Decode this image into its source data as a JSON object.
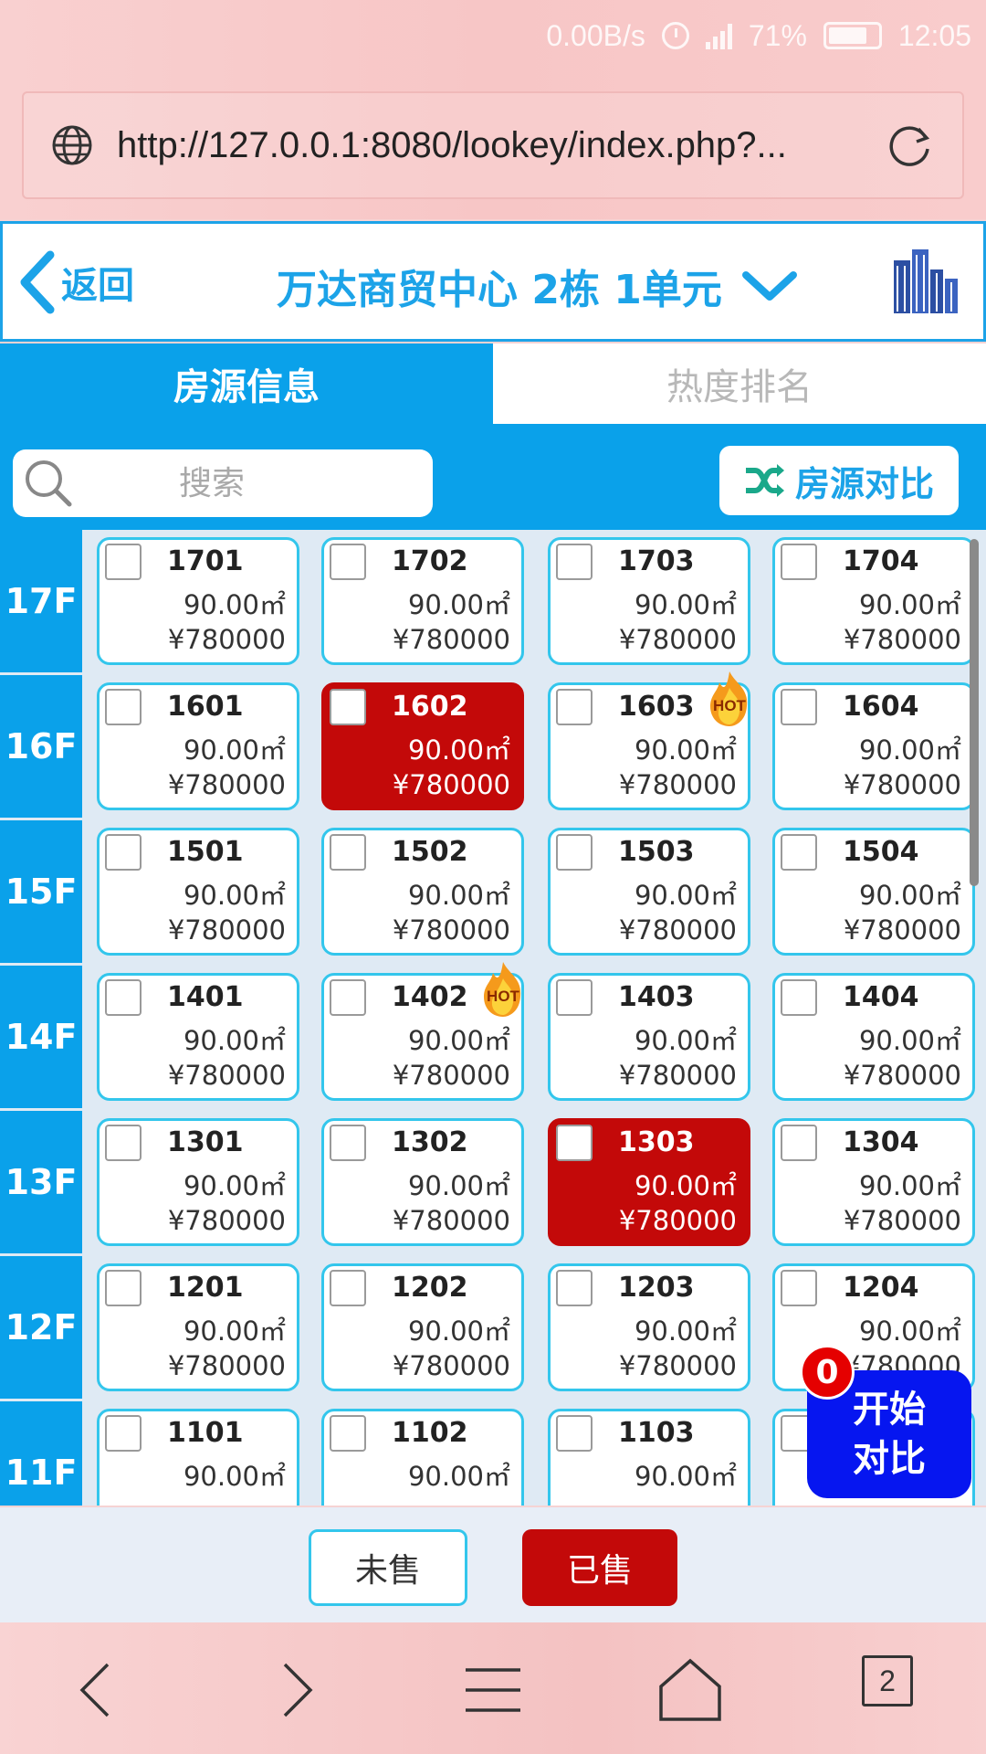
{
  "status_bar": {
    "speed": "0.00B/s",
    "network": "4G",
    "battery": "71%",
    "time": "12:05"
  },
  "browser": {
    "url": "http://127.0.0.1:8080/lookey/index.php?...",
    "tab_count": "2"
  },
  "header": {
    "back_label": "返回",
    "title": "万达商贸中心 2栋 1单元"
  },
  "tabs": [
    {
      "label": "房源信息",
      "active": true
    },
    {
      "label": "热度排名",
      "active": false
    }
  ],
  "search": {
    "placeholder": "搜索"
  },
  "compare_button": {
    "label": "房源对比"
  },
  "floors": [
    {
      "label": "17F",
      "units": [
        {
          "number": "1701",
          "area": "90.00㎡",
          "price": "¥780000",
          "sold": false,
          "hot": false
        },
        {
          "number": "1702",
          "area": "90.00㎡",
          "price": "¥780000",
          "sold": false,
          "hot": false
        },
        {
          "number": "1703",
          "area": "90.00㎡",
          "price": "¥780000",
          "sold": false,
          "hot": false
        },
        {
          "number": "1704",
          "area": "90.00㎡",
          "price": "¥780000",
          "sold": false,
          "hot": false
        }
      ]
    },
    {
      "label": "16F",
      "units": [
        {
          "number": "1601",
          "area": "90.00㎡",
          "price": "¥780000",
          "sold": false,
          "hot": false
        },
        {
          "number": "1602",
          "area": "90.00㎡",
          "price": "¥780000",
          "sold": true,
          "hot": false
        },
        {
          "number": "1603",
          "area": "90.00㎡",
          "price": "¥780000",
          "sold": false,
          "hot": true
        },
        {
          "number": "1604",
          "area": "90.00㎡",
          "price": "¥780000",
          "sold": false,
          "hot": false
        }
      ]
    },
    {
      "label": "15F",
      "units": [
        {
          "number": "1501",
          "area": "90.00㎡",
          "price": "¥780000",
          "sold": false,
          "hot": false
        },
        {
          "number": "1502",
          "area": "90.00㎡",
          "price": "¥780000",
          "sold": false,
          "hot": false
        },
        {
          "number": "1503",
          "area": "90.00㎡",
          "price": "¥780000",
          "sold": false,
          "hot": false
        },
        {
          "number": "1504",
          "area": "90.00㎡",
          "price": "¥780000",
          "sold": false,
          "hot": false
        }
      ]
    },
    {
      "label": "14F",
      "units": [
        {
          "number": "1401",
          "area": "90.00㎡",
          "price": "¥780000",
          "sold": false,
          "hot": false
        },
        {
          "number": "1402",
          "area": "90.00㎡",
          "price": "¥780000",
          "sold": false,
          "hot": true
        },
        {
          "number": "1403",
          "area": "90.00㎡",
          "price": "¥780000",
          "sold": false,
          "hot": false
        },
        {
          "number": "1404",
          "area": "90.00㎡",
          "price": "¥780000",
          "sold": false,
          "hot": false
        }
      ]
    },
    {
      "label": "13F",
      "units": [
        {
          "number": "1301",
          "area": "90.00㎡",
          "price": "¥780000",
          "sold": false,
          "hot": false
        },
        {
          "number": "1302",
          "area": "90.00㎡",
          "price": "¥780000",
          "sold": false,
          "hot": false
        },
        {
          "number": "1303",
          "area": "90.00㎡",
          "price": "¥780000",
          "sold": true,
          "hot": false
        },
        {
          "number": "1304",
          "area": "90.00㎡",
          "price": "¥780000",
          "sold": false,
          "hot": false
        }
      ]
    },
    {
      "label": "12F",
      "units": [
        {
          "number": "1201",
          "area": "90.00㎡",
          "price": "¥780000",
          "sold": false,
          "hot": false
        },
        {
          "number": "1202",
          "area": "90.00㎡",
          "price": "¥780000",
          "sold": false,
          "hot": false
        },
        {
          "number": "1203",
          "area": "90.00㎡",
          "price": "¥780000",
          "sold": false,
          "hot": false
        },
        {
          "number": "1204",
          "area": "90.00㎡",
          "price": "¥780000",
          "sold": false,
          "hot": false
        }
      ]
    },
    {
      "label": "11F",
      "units": [
        {
          "number": "1101",
          "area": "90.00㎡",
          "price": "",
          "sold": false,
          "hot": false
        },
        {
          "number": "1102",
          "area": "90.00㎡",
          "price": "",
          "sold": false,
          "hot": false
        },
        {
          "number": "1103",
          "area": "90.00㎡",
          "price": "",
          "sold": false,
          "hot": false
        },
        {
          "number": "",
          "area": "",
          "price": "",
          "sold": false,
          "hot": false
        }
      ]
    }
  ],
  "float_compare": {
    "count": "0",
    "label_line1": "开始",
    "label_line2": "对比"
  },
  "legend": {
    "unsold": "未售",
    "sold": "已售"
  },
  "hot_badge": {
    "text": "HOT"
  },
  "colors": {
    "primary": "#0aa1ea",
    "sold": "#c30909",
    "float_button": "#0616f0",
    "badge": "#e50000"
  }
}
